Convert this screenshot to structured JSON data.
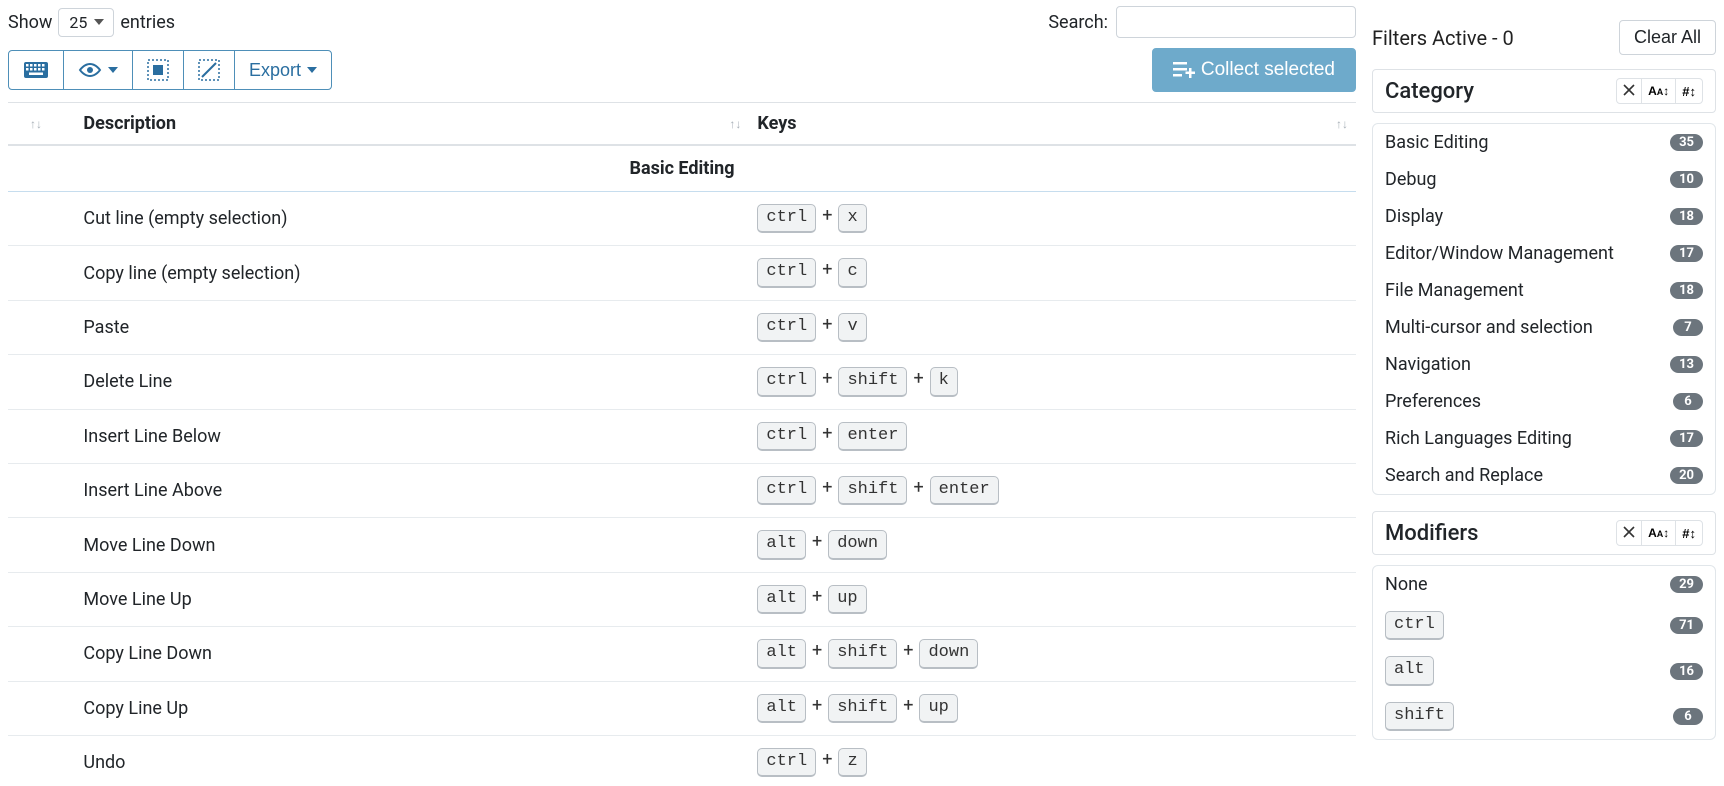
{
  "top": {
    "show_label": "Show",
    "entries_label": "entries",
    "entries_value": "25",
    "search_label": "Search:",
    "search_value": ""
  },
  "toolbar": {
    "export_label": "Export",
    "collect_label": "Collect selected"
  },
  "table": {
    "col_description": "Description",
    "col_keys": "Keys",
    "section": "Basic Editing",
    "rows": [
      {
        "desc": "Cut line (empty selection)",
        "keys": [
          "ctrl",
          "x"
        ]
      },
      {
        "desc": "Copy line (empty selection)",
        "keys": [
          "ctrl",
          "c"
        ]
      },
      {
        "desc": "Paste",
        "keys": [
          "ctrl",
          "v"
        ]
      },
      {
        "desc": "Delete Line",
        "keys": [
          "ctrl",
          "shift",
          "k"
        ]
      },
      {
        "desc": "Insert Line Below",
        "keys": [
          "ctrl",
          "enter"
        ]
      },
      {
        "desc": "Insert Line Above",
        "keys": [
          "ctrl",
          "shift",
          "enter"
        ]
      },
      {
        "desc": "Move Line Down",
        "keys": [
          "alt",
          "down"
        ]
      },
      {
        "desc": "Move Line Up",
        "keys": [
          "alt",
          "up"
        ]
      },
      {
        "desc": "Copy Line Down",
        "keys": [
          "alt",
          "shift",
          "down"
        ]
      },
      {
        "desc": "Copy Line Up",
        "keys": [
          "alt",
          "shift",
          "up"
        ]
      },
      {
        "desc": "Undo",
        "keys": [
          "ctrl",
          "z"
        ]
      }
    ]
  },
  "sidebar": {
    "filters_active_label": "Filters Active - 0",
    "clear_all_label": "Clear All",
    "panel_category_title": "Category",
    "panel_modifiers_title": "Modifiers",
    "categories": [
      {
        "label": "Basic Editing",
        "count": "35"
      },
      {
        "label": "Debug",
        "count": "10"
      },
      {
        "label": "Display",
        "count": "18"
      },
      {
        "label": "Editor/Window Management",
        "count": "17"
      },
      {
        "label": "File Management",
        "count": "18"
      },
      {
        "label": "Multi-cursor and selection",
        "count": "7"
      },
      {
        "label": "Navigation",
        "count": "13"
      },
      {
        "label": "Preferences",
        "count": "6"
      },
      {
        "label": "Rich Languages Editing",
        "count": "17"
      },
      {
        "label": "Search and Replace",
        "count": "20"
      }
    ],
    "modifiers": [
      {
        "label": "None",
        "count": "29",
        "kbd": false
      },
      {
        "label": "ctrl",
        "count": "71",
        "kbd": true
      },
      {
        "label": "alt",
        "count": "16",
        "kbd": true
      },
      {
        "label": "shift",
        "count": "6",
        "kbd": true
      }
    ]
  }
}
